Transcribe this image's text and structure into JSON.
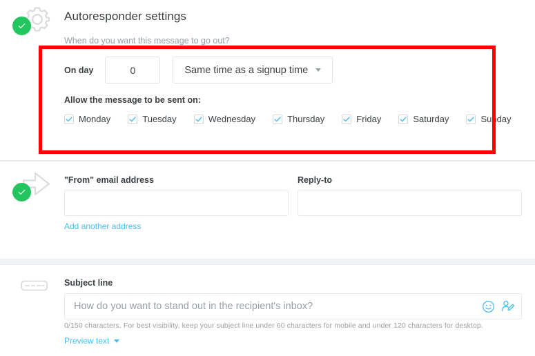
{
  "colors": {
    "accent_blue": "#4dbdf5",
    "success_green": "#22c55e",
    "highlight_red": "#ff0000",
    "text_primary": "#3c4043",
    "text_muted": "#9aa0a6",
    "card_bg": "#ffffff",
    "page_bg": "#f1f3f4",
    "border": "#e0e3e6"
  },
  "autoresponder": {
    "icon": "gear-icon",
    "status_badge_icon": "check-icon",
    "title": "Autoresponder settings",
    "subtitle": "When do you want this message to go out?",
    "on_day": {
      "label": "On day",
      "value": "0"
    },
    "time_select": {
      "selected": "Same time as a signup time",
      "caret_icon": "chevron-down-icon"
    },
    "days": {
      "heading": "Allow the message to be sent on:",
      "items": [
        {
          "label": "Monday",
          "checked": true
        },
        {
          "label": "Tuesday",
          "checked": true
        },
        {
          "label": "Wednesday",
          "checked": true
        },
        {
          "label": "Thursday",
          "checked": true
        },
        {
          "label": "Friday",
          "checked": true
        },
        {
          "label": "Saturday",
          "checked": true
        },
        {
          "label": "Sunday",
          "checked": true
        }
      ]
    }
  },
  "from_section": {
    "icon": "arrow-right-icon",
    "status_badge_icon": "check-icon",
    "from_label": "\"From\" email address",
    "from_value": "",
    "from_placeholder": "",
    "reply_label": "Reply-to",
    "reply_value": "",
    "reply_placeholder": "",
    "add_another_link": "Add another address"
  },
  "subject_section": {
    "icon": "subject-line-icon",
    "label": "Subject line",
    "value": "",
    "placeholder": "How do you want to stand out in the recipient's inbox?",
    "emoji_icon": "smiley-face-icon",
    "personalize_icon": "person-edit-icon",
    "help_text": "0/150 characters. For best visibility, keep your subject line under 60 characters for mobile and under 120 characters for desktop.",
    "preview_text_link": "Preview text",
    "preview_caret_icon": "chevron-down-icon"
  }
}
